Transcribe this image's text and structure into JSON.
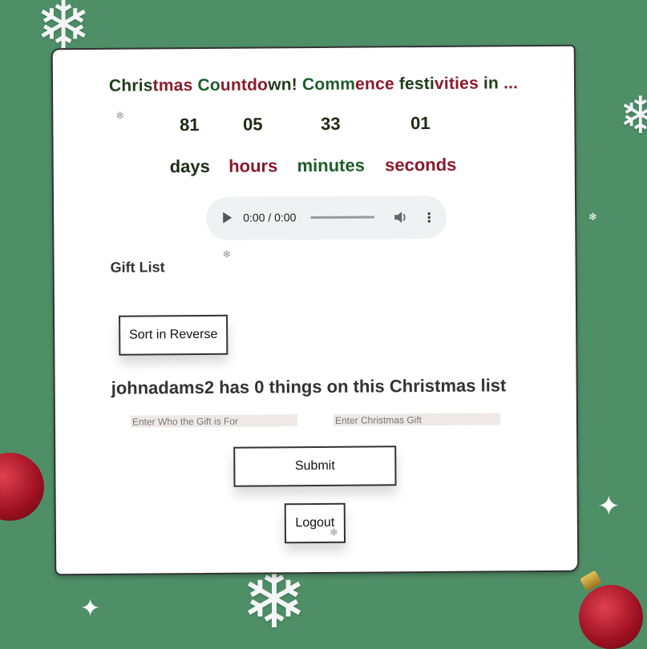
{
  "title_parts": [
    {
      "text": "Chris",
      "color": "#1f3d1a"
    },
    {
      "text": "tmas ",
      "color": "#8b1a2b"
    },
    {
      "text": "Co",
      "color": "#1f5d2a"
    },
    {
      "text": "untdo",
      "color": "#8b1a2b"
    },
    {
      "text": "wn! ",
      "color": "#1f3d1a"
    },
    {
      "text": "Comm",
      "color": "#1f5d2a"
    },
    {
      "text": "ence ",
      "color": "#8b1a2b"
    },
    {
      "text": "festi",
      "color": "#1f3d1a"
    },
    {
      "text": "vities ",
      "color": "#8b1a2b"
    },
    {
      "text": "in ",
      "color": "#1f3d1a"
    },
    {
      "text": "...",
      "color": "#8b1a2b"
    }
  ],
  "countdown": {
    "days": "81",
    "hours": "05",
    "minutes": "33",
    "seconds": "01",
    "days_label": "days",
    "hours_label": "hours",
    "minutes_label": "minutes",
    "seconds_label": "seconds"
  },
  "audio": {
    "time": "0:00 / 0:00"
  },
  "gift_list": {
    "heading": "Gift List",
    "sort_label": "Sort in Reverse",
    "summary": "johnadams2 has 0 things on this Christmas list",
    "recipient_placeholder": "Enter Who the Gift is For",
    "gift_placeholder": "Enter Christmas Gift",
    "submit_label": "Submit",
    "logout_label": "Logout"
  },
  "colors": {
    "background": "#4f8f68",
    "dark_green": "#1f3d1a",
    "red": "#8b1a2b",
    "green": "#1f5d2a"
  },
  "icons": [
    "play-icon",
    "volume-icon",
    "more-vert-icon",
    "snowflake-icon",
    "sparkle-icon",
    "ornament-icon"
  ]
}
